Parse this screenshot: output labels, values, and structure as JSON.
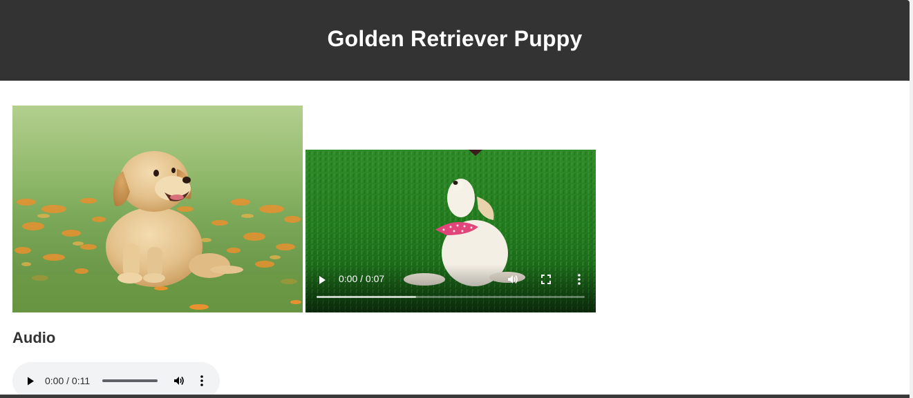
{
  "page": {
    "title": "Golden Retriever Puppy"
  },
  "colors": {
    "header_bg": "#333333",
    "header_text": "#ffffff",
    "audio_player_bg": "#f1f3f4"
  },
  "image": {
    "subject": "golden-retriever-puppy-sitting-in-grass"
  },
  "video": {
    "subject": "white-puppy-with-pink-bandana-on-grass",
    "time_display": "0:00 / 0:07",
    "current_time": "0:00",
    "duration": "0:07",
    "played_fraction": 0,
    "buffered_fraction": 0.37,
    "icons": {
      "play": "play-icon",
      "volume": "volume-icon",
      "fullscreen": "fullscreen-icon",
      "more": "more-options-icon"
    }
  },
  "audio": {
    "heading": "Audio",
    "time_display": "0:00 / 0:11",
    "current_time": "0:00",
    "duration": "0:11",
    "played_fraction": 0,
    "icons": {
      "play": "play-icon",
      "volume": "volume-icon",
      "more": "more-options-icon"
    }
  }
}
